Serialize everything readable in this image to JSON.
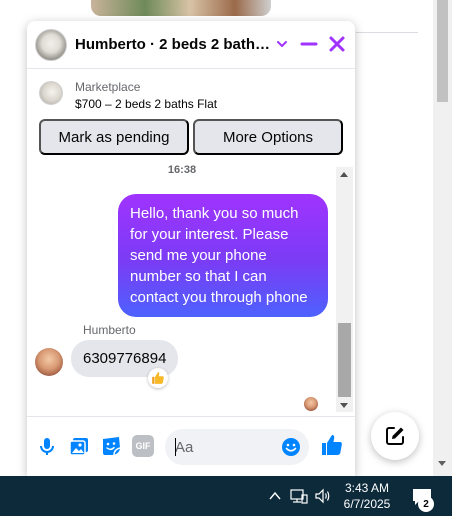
{
  "chat": {
    "title": "Humberto · 2 beds 2 baths…",
    "listing": {
      "source": "Marketplace",
      "title": "$700 – 2 beds 2 baths Flat"
    },
    "actions": {
      "mark_pending": "Mark as pending",
      "more_options": "More Options"
    },
    "timestamp": "16:38",
    "outgoing_message": "Hello, thank you so much for your interest. Please send me your phone number so that I can contact you through phone",
    "sender_name": "Humberto",
    "incoming_message": "6309776894",
    "reaction_icon": "thumbs-up-icon",
    "composer": {
      "placeholder": "Aa",
      "gif_label": "GIF"
    },
    "colors": {
      "accent": "#0084ff",
      "outgoing_gradient_top": "#a033ff",
      "outgoing_gradient_bottom": "#4d62ff",
      "header_accent": "#a033ff"
    }
  },
  "taskbar": {
    "time": "3:43 AM",
    "date": "6/7/2025",
    "notification_count": "2"
  }
}
